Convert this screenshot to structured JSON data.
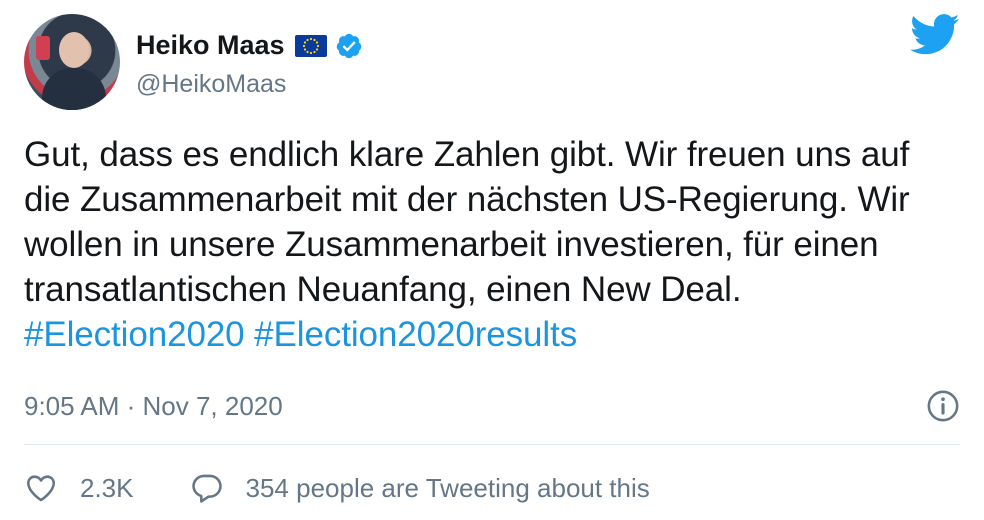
{
  "tweet": {
    "author": {
      "name": "Heiko Maas",
      "handle": "@HeikoMaas",
      "flag_icon": "eu-flag",
      "verified_icon": "verified-badge"
    },
    "text_parts": {
      "body": "Gut, dass es endlich klare Zahlen gibt. Wir freuen uns auf die Zusammenarbeit mit der nächsten US-Regierung. Wir wollen in unsere Zusammenarbeit investieren, für einen transatlantischen Neuanfang, einen New Deal.",
      "hashtag1": "#Election2020",
      "hashtag2": "#Election2020results"
    },
    "timestamp": "9:05 AM · Nov 7, 2020",
    "likes": "2.3K",
    "tweeting_about": "354 people are Tweeting about this",
    "colors": {
      "link": "#1b95e0",
      "secondary": "#657786",
      "text": "#14171a",
      "brand": "#1da1f2",
      "verified": "#1da1f2"
    }
  }
}
